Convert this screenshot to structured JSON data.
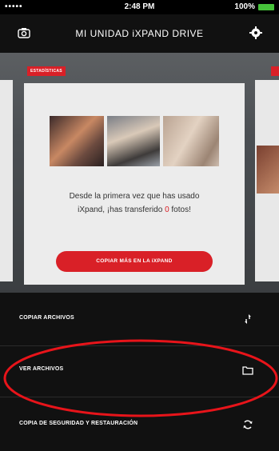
{
  "status_bar": {
    "signal": "•••••",
    "time": "2:48 PM",
    "battery": "100%"
  },
  "header": {
    "title": "MI UNIDAD iXPAND DRIVE",
    "left_icon": "camera-icon",
    "right_icon": "gear-icon"
  },
  "carousel": {
    "badge": "ESTADÍSTICAS",
    "card": {
      "text_line1": "Desde la primera vez que has usado",
      "text_line2_prefix": "iXpand, ¡has transferido",
      "photo_count": "0",
      "text_line2_suffix": "fotos!",
      "button_label": "COPIAR MÁS EN LA iXPAND"
    }
  },
  "menu": {
    "items": [
      {
        "label": "COPIAR ARCHIVOS",
        "icon": "arrows-icon"
      },
      {
        "label": "VER ARCHIVOS",
        "icon": "folder-icon"
      },
      {
        "label": "COPIA DE SEGURIDAD Y RESTAURACIÓN",
        "icon": "sync-icon"
      }
    ]
  },
  "colors": {
    "accent": "#d92027",
    "background": "#111111",
    "card": "#ececec",
    "highlight": "#e8141a"
  }
}
